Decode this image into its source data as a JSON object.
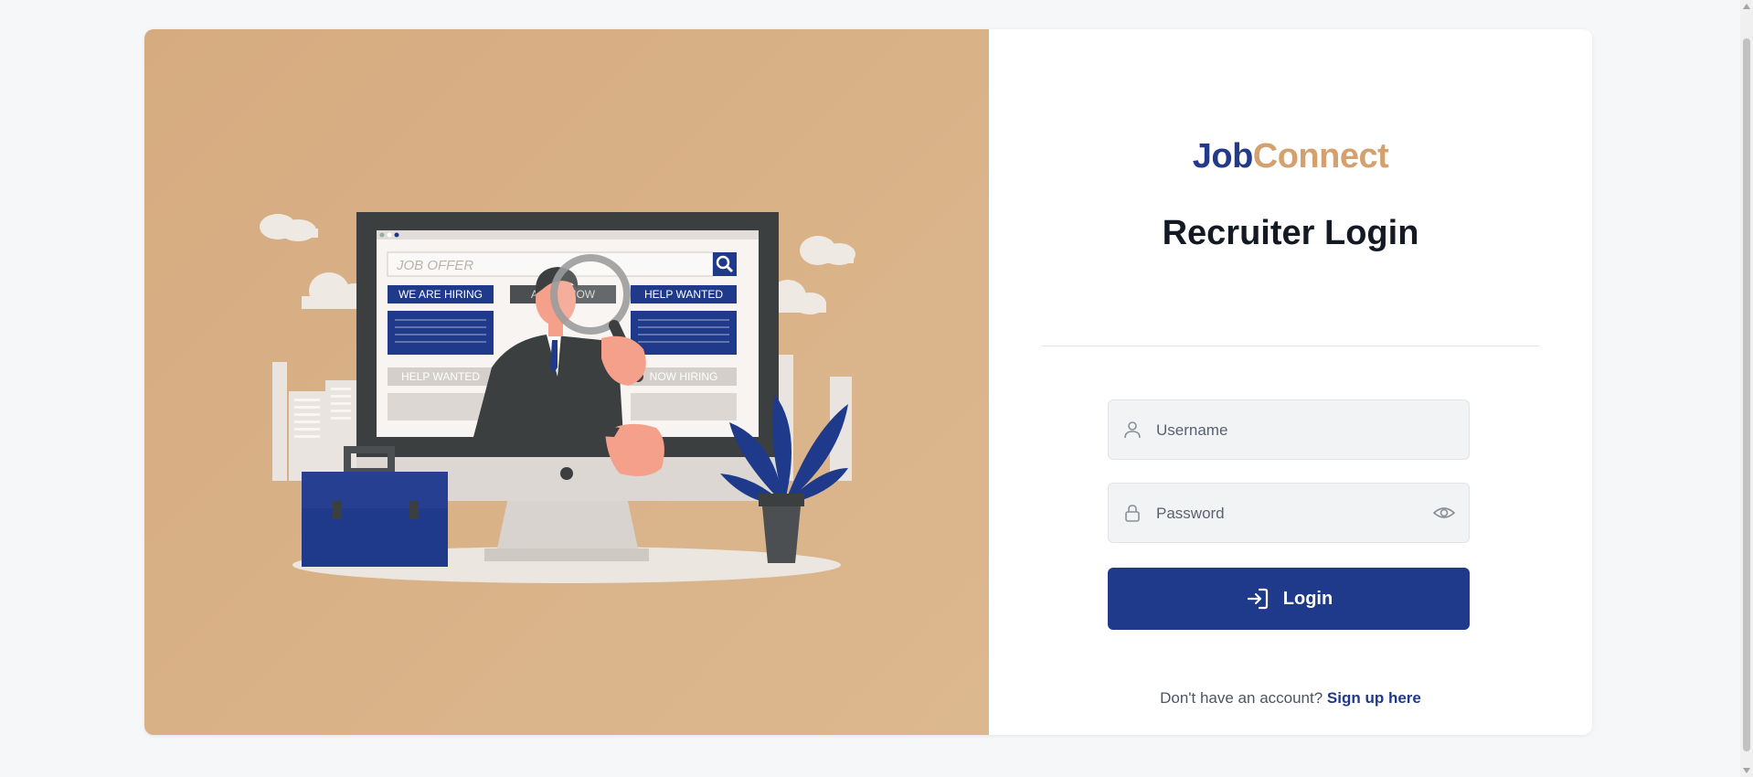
{
  "brand": {
    "part1": "Job",
    "part2": "Connect"
  },
  "page_title": "Recruiter Login",
  "form": {
    "username": {
      "placeholder": "Username",
      "value": ""
    },
    "password": {
      "placeholder": "Password",
      "value": ""
    },
    "submit_label": "Login"
  },
  "signup": {
    "prompt": "Don't have an account?",
    "link": "Sign up here"
  },
  "illustration": {
    "search_text": "JOB OFFER",
    "tags": [
      "WE ARE HIRING",
      "APPLY NOW",
      "HELP WANTED",
      "HELP WANTED",
      "NOW HIRING"
    ]
  },
  "colors": {
    "brand_primary": "#1f3a8a",
    "brand_accent": "#d4a06d",
    "illustration_bg": "#d9b186"
  },
  "icons": {
    "username": "user-icon",
    "password": "lock-icon",
    "show_password": "eye-icon",
    "login": "sign-in-icon"
  }
}
